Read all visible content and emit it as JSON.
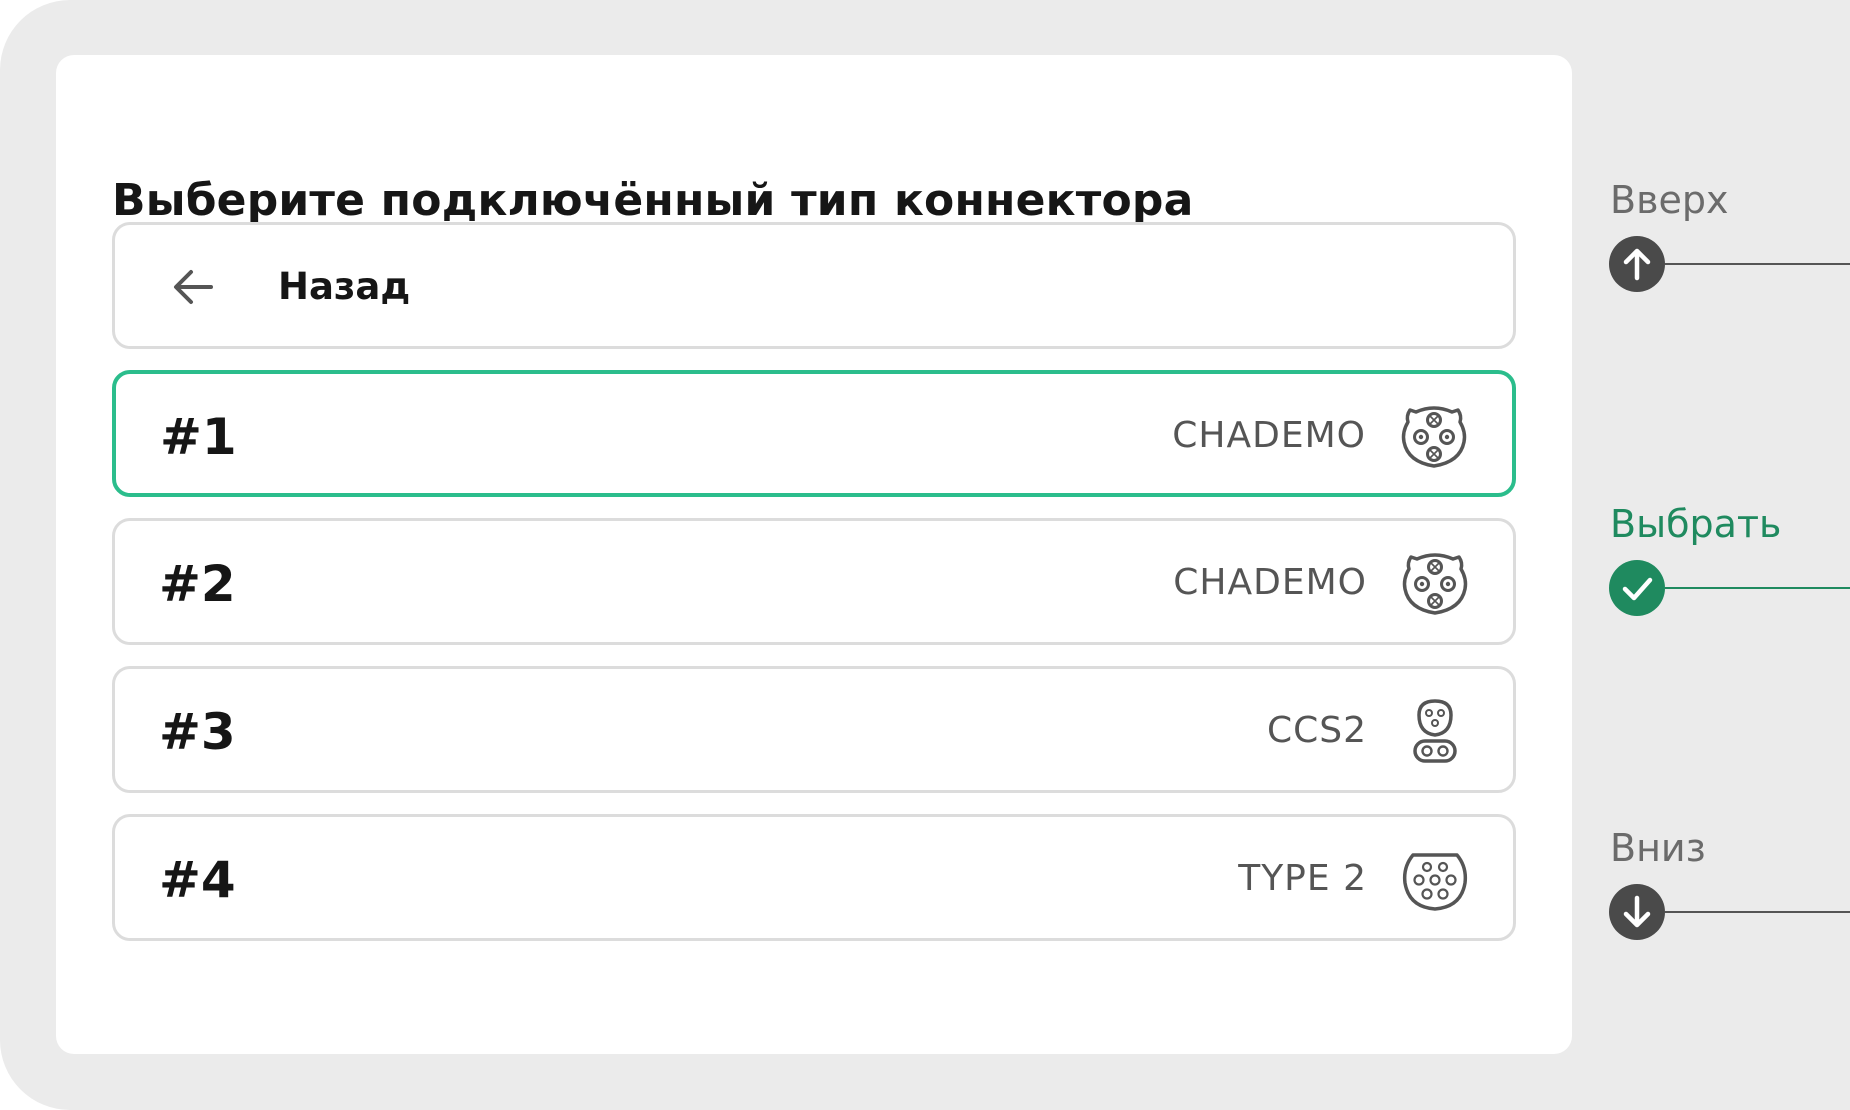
{
  "screen": {
    "title": "Выберите подключённый тип коннектора",
    "back": {
      "label": "Назад",
      "icon": "arrow-left-icon"
    },
    "connectors": [
      {
        "number": "#1",
        "type": "CHADEMO",
        "icon": "chademo-connector-icon",
        "selected": true
      },
      {
        "number": "#2",
        "type": "CHADEMO",
        "icon": "chademo-connector-icon",
        "selected": false
      },
      {
        "number": "#3",
        "type": "CCS2",
        "icon": "ccs2-connector-icon",
        "selected": false
      },
      {
        "number": "#4",
        "type": "TYPE 2",
        "icon": "type2-connector-icon",
        "selected": false
      }
    ]
  },
  "side_controls": {
    "up": {
      "label": "Вверх",
      "icon": "arrow-up-icon"
    },
    "select": {
      "label": "Выбрать",
      "icon": "check-icon"
    },
    "down": {
      "label": "Вниз",
      "icon": "arrow-down-icon"
    }
  },
  "colors": {
    "accent": "#2bbd8c",
    "accent_dark": "#1f8a5f",
    "button_dark": "#4a4a4a",
    "frame": "#ebebeb",
    "border": "#dcdcdc",
    "text": "#161616",
    "muted": "#555555"
  }
}
